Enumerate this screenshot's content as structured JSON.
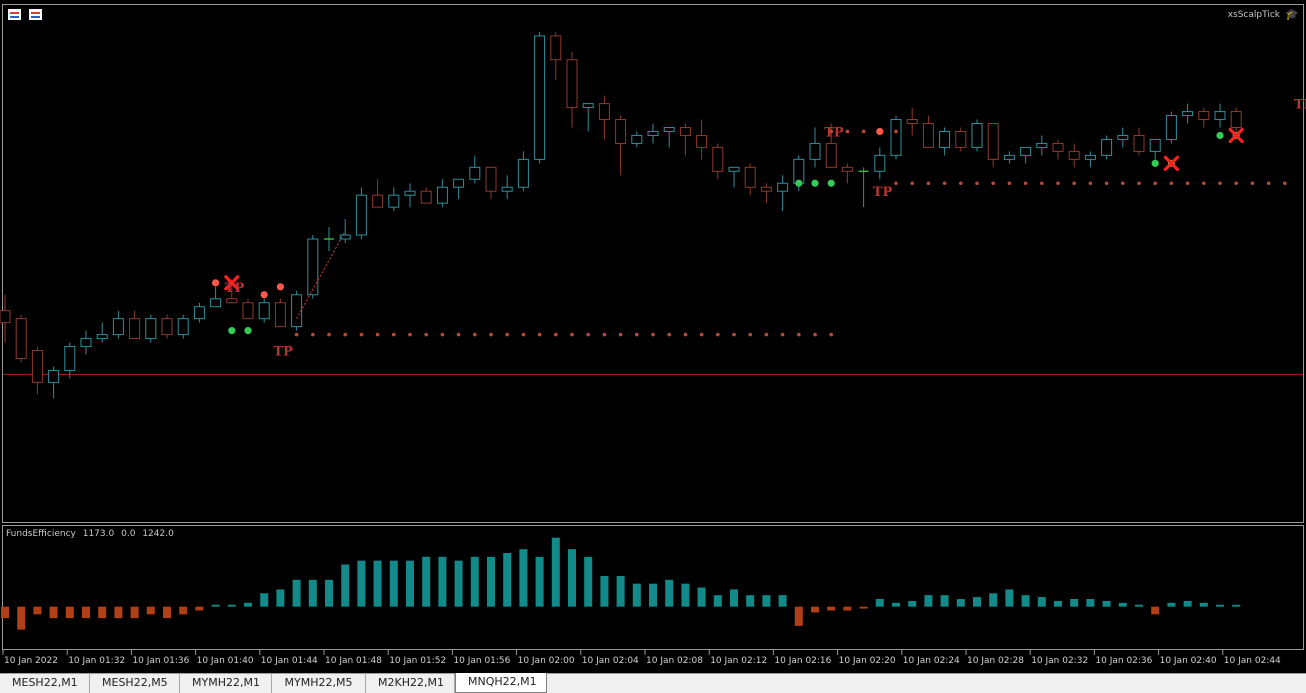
{
  "window": {
    "ea_name": "xsScalpTick",
    "indicator": {
      "name": "FundsEfficiency",
      "values": [
        "1173.0",
        "0.0",
        "1242.0"
      ]
    }
  },
  "colors": {
    "bull": "#2e8f9a",
    "bear": "#8e3a2c",
    "bull_fill": "#000000",
    "bear_fill": "#000000",
    "marker_red": "#ff5a4a",
    "marker_green": "#33cc55",
    "tp_text": "#c03030",
    "dots": "#b84a3a",
    "hist_pos": "#138a8a",
    "hist_neg": "#b04018",
    "grid_line": "#b02020"
  },
  "time_axis": [
    "10 Jan 2022",
    "10 Jan 01:32",
    "10 Jan 01:36",
    "10 Jan 01:40",
    "10 Jan 01:44",
    "10 Jan 01:48",
    "10 Jan 01:52",
    "10 Jan 01:56",
    "10 Jan 02:00",
    "10 Jan 02:04",
    "10 Jan 02:08",
    "10 Jan 02:12",
    "10 Jan 02:16",
    "10 Jan 02:20",
    "10 Jan 02:24",
    "10 Jan 02:28",
    "10 Jan 02:32",
    "10 Jan 02:36",
    "10 Jan 02:40",
    "10 Jan 02:44"
  ],
  "tabs": [
    {
      "label": "MESH22,M1",
      "active": false
    },
    {
      "label": "MESH22,M5",
      "active": false
    },
    {
      "label": "MYMH22,M1",
      "active": false
    },
    {
      "label": "MYMH22,M5",
      "active": false
    },
    {
      "label": "M2KH22,M1",
      "active": false
    },
    {
      "label": "MNQH22,M1",
      "active": true
    }
  ],
  "chart_data": {
    "type": "candlestick",
    "series": [
      {
        "name": "price",
        "note": "candles: open, high, low, close in relative price units"
      }
    ],
    "candles": [
      [
        60,
        64,
        52,
        57
      ],
      [
        58,
        59,
        47,
        48
      ],
      [
        50,
        51,
        39,
        42
      ],
      [
        42,
        46,
        38,
        45
      ],
      [
        45,
        52,
        43,
        51
      ],
      [
        51,
        55,
        49,
        53
      ],
      [
        53,
        57,
        52,
        54
      ],
      [
        54,
        60,
        53,
        58
      ],
      [
        58,
        60,
        53,
        53
      ],
      [
        53,
        59,
        52,
        58
      ],
      [
        58,
        59,
        53,
        54
      ],
      [
        54,
        59,
        53,
        58
      ],
      [
        58,
        62,
        57,
        61
      ],
      [
        61,
        66,
        61,
        63
      ],
      [
        63,
        67,
        62,
        62
      ],
      [
        62,
        63,
        58,
        58
      ],
      [
        58,
        63,
        57,
        62
      ],
      [
        62,
        63,
        56,
        56
      ],
      [
        56,
        65,
        55,
        64
      ],
      [
        64,
        79,
        63,
        78
      ],
      [
        78,
        81,
        75,
        78
      ],
      [
        78,
        83,
        77,
        79
      ],
      [
        79,
        91,
        78,
        89
      ],
      [
        89,
        93,
        86,
        86
      ],
      [
        86,
        91,
        85,
        89
      ],
      [
        89,
        92,
        86,
        90
      ],
      [
        90,
        91,
        87,
        87
      ],
      [
        87,
        93,
        86,
        91
      ],
      [
        91,
        93,
        88,
        93
      ],
      [
        93,
        99,
        92,
        96
      ],
      [
        96,
        96,
        88,
        90
      ],
      [
        90,
        94,
        88,
        91
      ],
      [
        91,
        100,
        90,
        98
      ],
      [
        98,
        130,
        97,
        129
      ],
      [
        129,
        130,
        118,
        123
      ],
      [
        123,
        125,
        106,
        111
      ],
      [
        111,
        112,
        105,
        112
      ],
      [
        112,
        114,
        103,
        108
      ],
      [
        108,
        109,
        94,
        102
      ],
      [
        102,
        105,
        101,
        104
      ],
      [
        104,
        107,
        102,
        105
      ],
      [
        105,
        106,
        101,
        106
      ],
      [
        106,
        107,
        99,
        104
      ],
      [
        104,
        108,
        98,
        101
      ],
      [
        101,
        102,
        93,
        95
      ],
      [
        95,
        95,
        91,
        96
      ],
      [
        96,
        97,
        89,
        91
      ],
      [
        91,
        92,
        87,
        90
      ],
      [
        90,
        94,
        85,
        92
      ],
      [
        92,
        99,
        90,
        98
      ],
      [
        98,
        106,
        96,
        102
      ],
      [
        102,
        107,
        96,
        96
      ],
      [
        96,
        97,
        92,
        95
      ],
      [
        95,
        96,
        86,
        95
      ],
      [
        95,
        101,
        93,
        99
      ],
      [
        99,
        109,
        98,
        108
      ],
      [
        108,
        111,
        104,
        107
      ],
      [
        107,
        109,
        102,
        101
      ],
      [
        101,
        106,
        99,
        105
      ],
      [
        105,
        106,
        100,
        101
      ],
      [
        101,
        108,
        100,
        107
      ],
      [
        107,
        107,
        96,
        98
      ],
      [
        98,
        100,
        97,
        99
      ],
      [
        99,
        101,
        97,
        101
      ],
      [
        101,
        104,
        99,
        102
      ],
      [
        102,
        103,
        98,
        100
      ],
      [
        100,
        102,
        96,
        98
      ],
      [
        98,
        100,
        96,
        99
      ],
      [
        99,
        104,
        98,
        103
      ],
      [
        103,
        106,
        101,
        104
      ],
      [
        104,
        106,
        99,
        100
      ],
      [
        100,
        103,
        98,
        103
      ],
      [
        103,
        110,
        102,
        109
      ],
      [
        109,
        112,
        107,
        110
      ],
      [
        110,
        111,
        106,
        108
      ],
      [
        108,
        112,
        106,
        110
      ],
      [
        110,
        111,
        105,
        106
      ]
    ],
    "histogram": [
      -0.3,
      -0.6,
      -0.2,
      -0.3,
      -0.3,
      -0.3,
      -0.3,
      -0.3,
      -0.3,
      -0.2,
      -0.3,
      -0.2,
      -0.1,
      0.05,
      0.05,
      0.1,
      0.35,
      0.45,
      0.7,
      0.7,
      0.7,
      1.1,
      1.2,
      1.2,
      1.2,
      1.2,
      1.3,
      1.3,
      1.2,
      1.3,
      1.3,
      1.4,
      1.5,
      1.3,
      1.8,
      1.5,
      1.3,
      0.8,
      0.8,
      0.6,
      0.6,
      0.7,
      0.6,
      0.5,
      0.3,
      0.45,
      0.3,
      0.3,
      0.3,
      -0.5,
      -0.15,
      -0.1,
      -0.1,
      -0.05,
      0.2,
      0.1,
      0.15,
      0.3,
      0.3,
      0.2,
      0.25,
      0.35,
      0.45,
      0.3,
      0.25,
      0.15,
      0.2,
      0.2,
      0.15,
      0.1,
      0.05,
      -0.2,
      0.1,
      0.15,
      0.1,
      0.05,
      0.05
    ],
    "annotations": [
      {
        "label": "TP",
        "x_index": 17,
        "price": 50
      },
      {
        "label": "TP",
        "x_index": 51,
        "price": 105
      },
      {
        "label": "TP",
        "x_index": 54,
        "price": 90
      },
      {
        "label": "TP",
        "x_index": 80,
        "price": 112
      },
      {
        "label": "TP",
        "x_index": 14,
        "price": 66
      }
    ],
    "take_profit_levels": [
      {
        "from_index": 18,
        "to_index": 51,
        "price": 54
      },
      {
        "from_index": 55,
        "to_index": 80,
        "price": 92
      },
      {
        "from_index": 51,
        "to_index": 55,
        "price": 105
      }
    ],
    "exit_marks": [
      {
        "index": 14,
        "price": 67
      },
      {
        "index": 72,
        "price": 97
      },
      {
        "index": 76,
        "price": 104
      }
    ],
    "signals": [
      {
        "index": 13,
        "price": 67,
        "color": "red"
      },
      {
        "index": 16,
        "price": 64,
        "color": "red"
      },
      {
        "index": 17,
        "price": 66,
        "color": "red"
      },
      {
        "index": 14,
        "price": 55,
        "color": "green"
      },
      {
        "index": 15,
        "price": 55,
        "color": "green"
      },
      {
        "index": 49,
        "price": 92,
        "color": "green"
      },
      {
        "index": 50,
        "price": 92,
        "color": "green"
      },
      {
        "index": 51,
        "price": 92,
        "color": "green"
      },
      {
        "index": 54,
        "price": 105,
        "color": "red"
      },
      {
        "index": 71,
        "price": 97,
        "color": "green"
      },
      {
        "index": 72,
        "price": 97,
        "color": "green"
      },
      {
        "index": 75,
        "price": 104,
        "color": "green"
      },
      {
        "index": 76,
        "price": 104,
        "color": "green"
      },
      {
        "index": 80,
        "price": 101,
        "color": "green"
      }
    ],
    "horizontal_line_price": 44,
    "y_range": [
      20,
      135
    ],
    "hist_range": [
      -1,
      2
    ]
  }
}
